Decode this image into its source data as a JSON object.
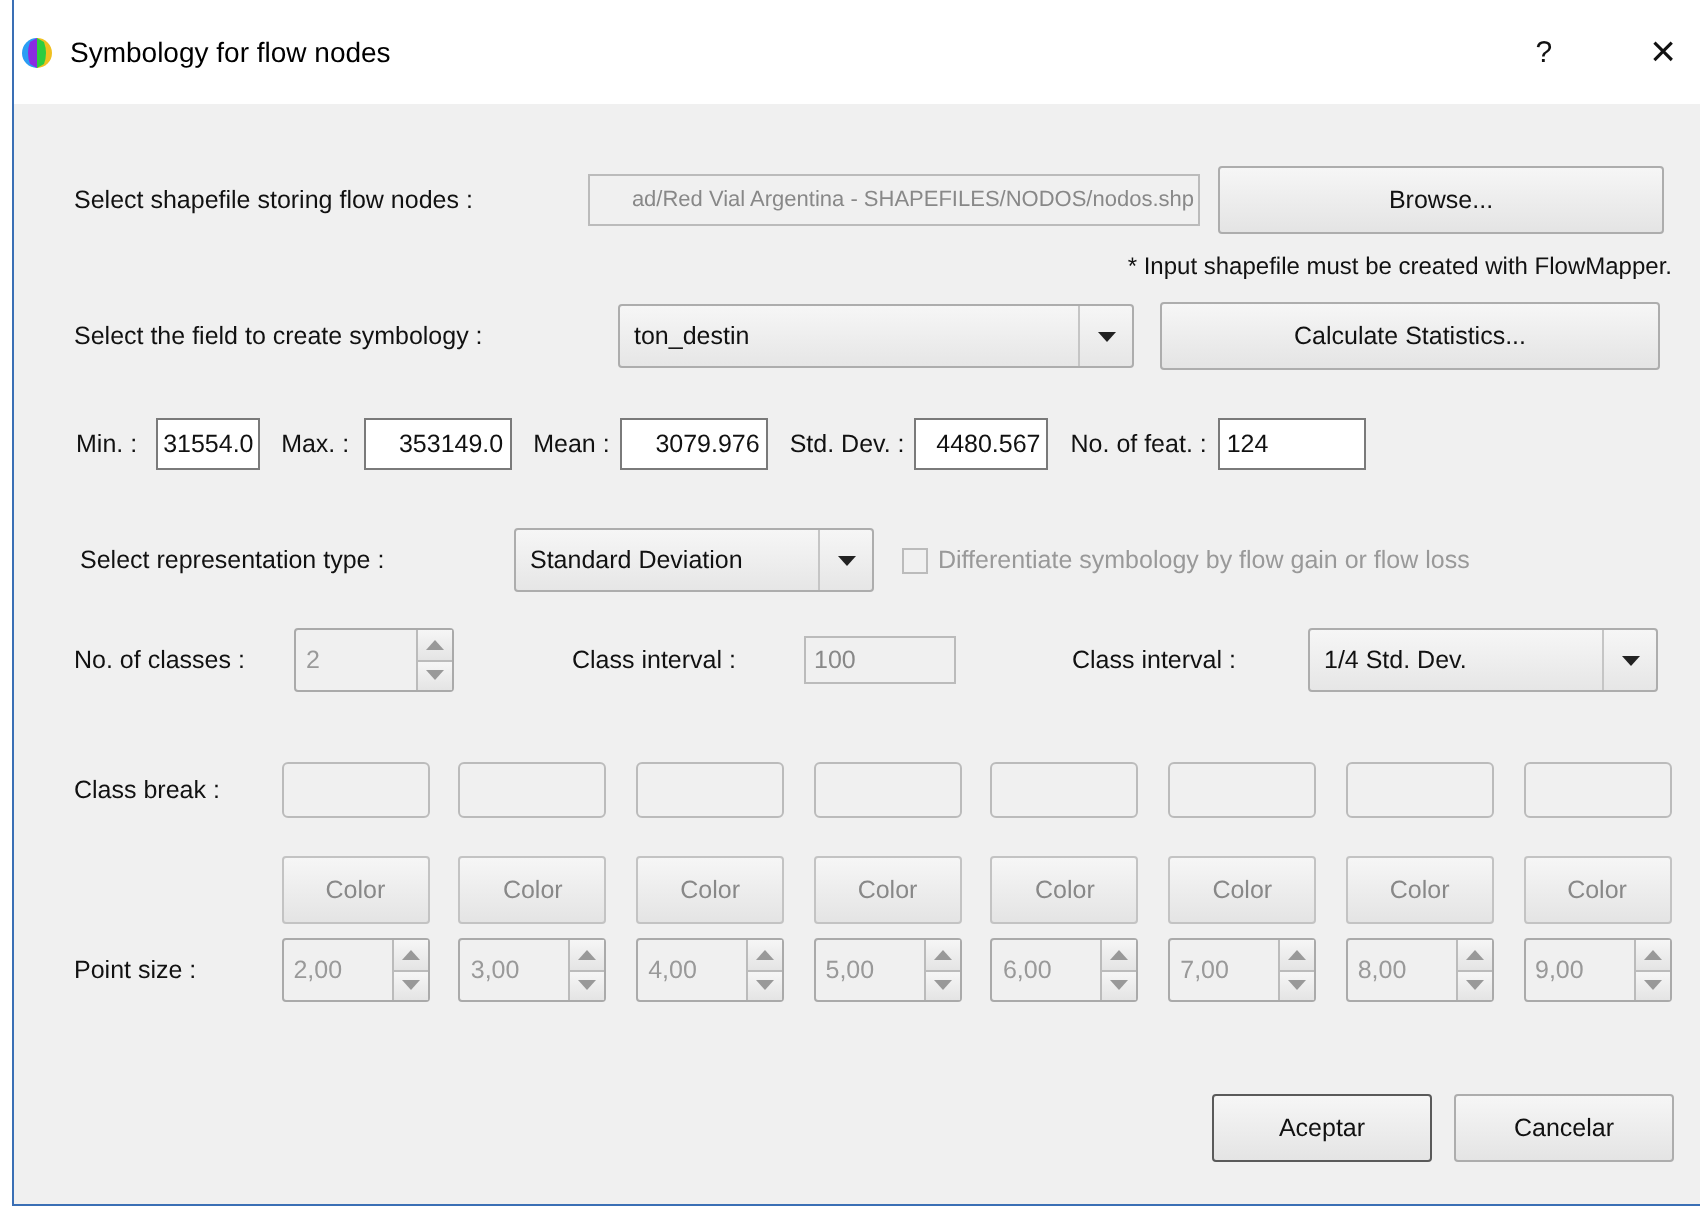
{
  "window": {
    "title": "Symbology for flow nodes",
    "help": "?",
    "close": "×"
  },
  "shapefile": {
    "label": "Select shapefile storing flow nodes :",
    "value": "ad/Red Vial Argentina - SHAPEFILES/NODOS/nodos.shp",
    "disabled": true,
    "button": "Browse...",
    "note": "* Input shapefile must be created with FlowMapper."
  },
  "field": {
    "label": "Select the field to create symbology :",
    "value": "ton_destin",
    "button": "Calculate Statistics..."
  },
  "stats": [
    {
      "label": "Min. :",
      "value": "31554.0"
    },
    {
      "label": "Max. :",
      "value": "353149.0"
    },
    {
      "label": "Mean :",
      "value": "3079.976"
    },
    {
      "label": "Std. Dev. :",
      "value": "4480.567"
    },
    {
      "label": "No. of feat. :",
      "value": "124"
    }
  ],
  "representation": {
    "label": "Select representation type :",
    "value": "Standard Deviation",
    "checkbox": {
      "label": "Differentiate symbology by flow gain or flow loss",
      "checked": false,
      "disabled": true
    }
  },
  "classes": {
    "label": "No. of classes :",
    "value": "2",
    "disabled": true
  },
  "class_interval_value": {
    "label": "Class interval :",
    "value": "100",
    "disabled": true
  },
  "class_interval_type": {
    "label": "Class interval :",
    "value": "1/4 Std. Dev."
  },
  "class_break": {
    "label": "Class break :",
    "count_disabled": [
      true,
      true,
      true,
      true,
      true,
      true,
      true,
      true
    ]
  },
  "color_buttons": [
    {
      "label": "Color",
      "disabled": true
    },
    {
      "label": "Color",
      "disabled": true
    },
    {
      "label": "Color",
      "disabled": true
    },
    {
      "label": "Color",
      "disabled": true
    },
    {
      "label": "Color",
      "disabled": true
    },
    {
      "label": "Color",
      "disabled": true
    },
    {
      "label": "Color",
      "disabled": true
    },
    {
      "label": "Color",
      "disabled": true
    }
  ],
  "point_size": {
    "label": "Point size :",
    "values": [
      {
        "value": "2,00",
        "disabled": true
      },
      {
        "value": "3,00",
        "disabled": true
      },
      {
        "value": "4,00",
        "disabled": true
      },
      {
        "value": "5,00",
        "disabled": true
      },
      {
        "value": "6,00",
        "disabled": true
      },
      {
        "value": "7,00",
        "disabled": true
      },
      {
        "value": "8,00",
        "disabled": true
      },
      {
        "value": "9,00",
        "disabled": true
      }
    ]
  },
  "buttons": [
    "Aceptar",
    "Cancelar"
  ]
}
